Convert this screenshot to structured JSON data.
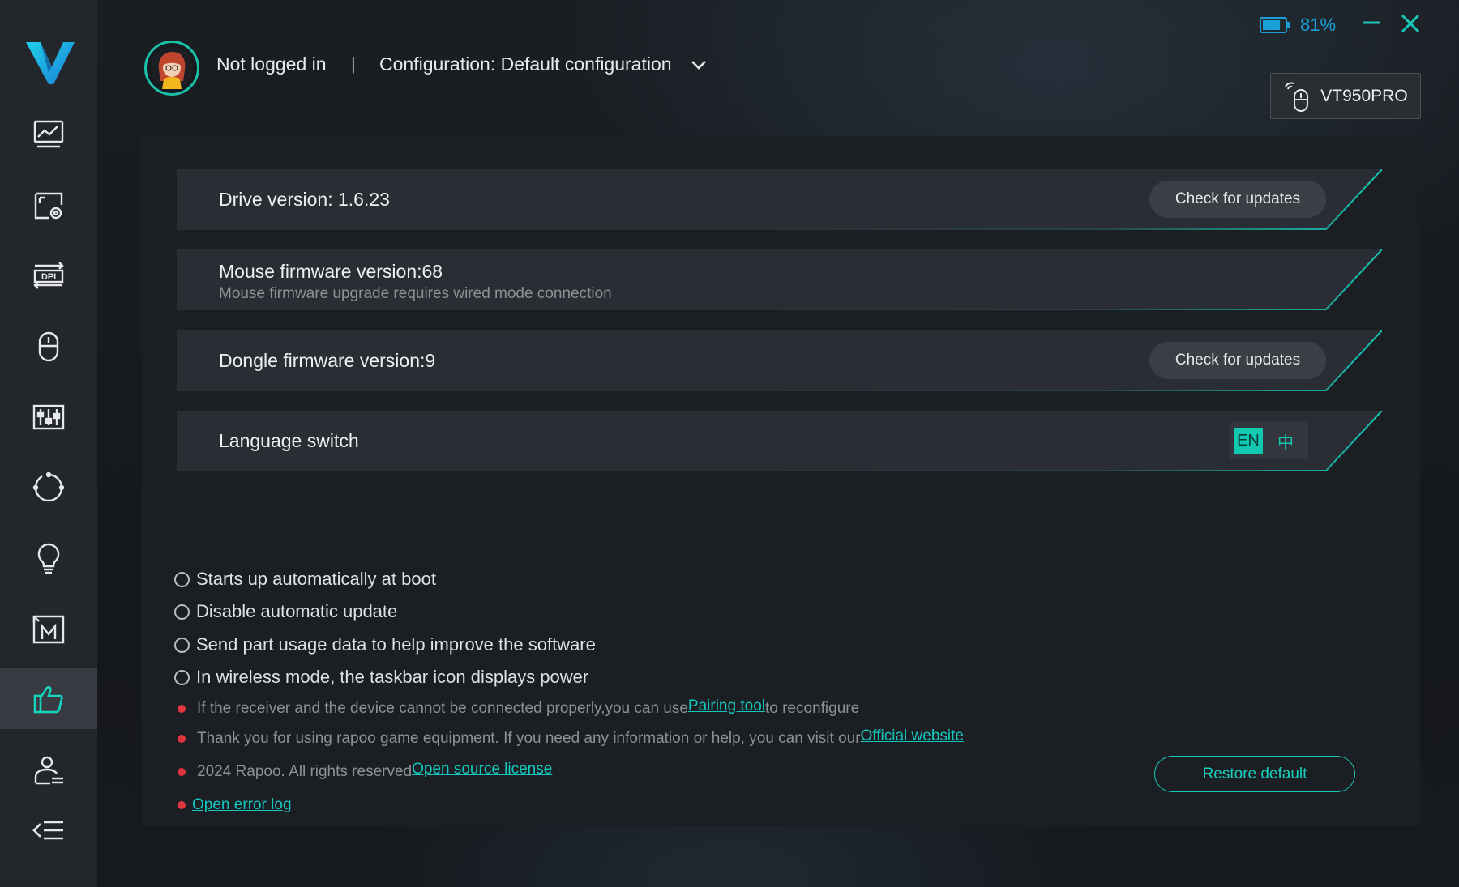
{
  "header": {
    "login_status": "Not logged in",
    "separator": "|",
    "configuration": "Configuration: Default configuration"
  },
  "status": {
    "battery_percent": "81%",
    "battery_level": 0.81,
    "device_name": "VT950PRO"
  },
  "sidebar": {
    "items": [
      {
        "icon": "performance-icon"
      },
      {
        "icon": "screen-settings-icon"
      },
      {
        "icon": "dpi-icon"
      },
      {
        "icon": "mouse-icon"
      },
      {
        "icon": "equalizer-icon"
      },
      {
        "icon": "sync-icon"
      },
      {
        "icon": "lighting-icon"
      },
      {
        "icon": "macro-icon"
      },
      {
        "icon": "thumbs-up-icon",
        "active": true
      },
      {
        "icon": "user-account-icon"
      },
      {
        "icon": "collapse-menu-icon"
      }
    ]
  },
  "versions": {
    "drive": "Drive version: 1.6.23",
    "mouse_firmware": "Mouse firmware version:68",
    "mouse_firmware_note": "Mouse firmware upgrade requires wired mode connection",
    "dongle_firmware": "Dongle firmware version:9",
    "check_updates_label": "Check for updates"
  },
  "language": {
    "label": "Language switch",
    "options": [
      "EN",
      "中"
    ],
    "selected": "EN"
  },
  "options": [
    "Starts up automatically at boot",
    "Disable automatic update",
    "Send part usage data to help improve the software",
    "In wireless mode, the taskbar icon displays power"
  ],
  "info": {
    "pairing_text_before": "If the receiver and the device cannot be connected properly,you can use",
    "pairing_link": "Pairing tool",
    "pairing_text_after": "to reconfigure",
    "thanks_text": "Thank you for using rapoo game equipment. If you need any information or help, you can visit our",
    "website_link": "Official website",
    "copyright_text": "2024 Rapoo. All rights reserved",
    "license_link": "Open source license",
    "error_log_link": "Open error log"
  },
  "restore_default_label": "Restore default",
  "colors": {
    "accent": "#14c8b4",
    "battery": "#1aa0d8",
    "bullet": "#e03540",
    "sidebar": "#23262b"
  }
}
